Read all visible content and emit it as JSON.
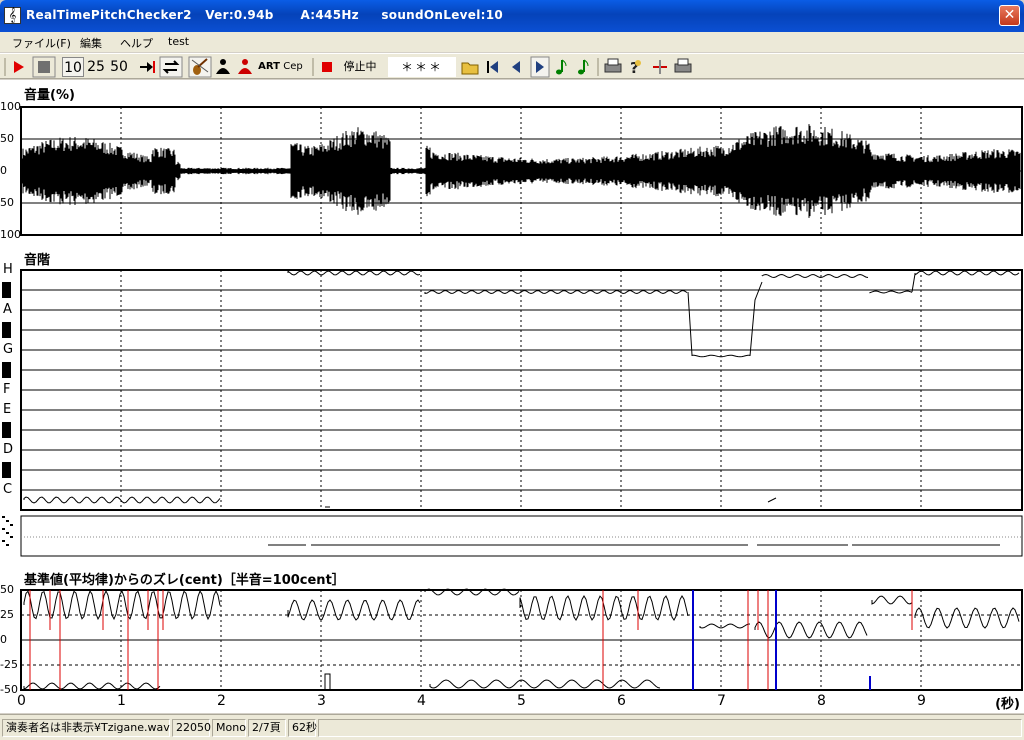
{
  "window": {
    "title": "RealTimePitchChecker2   Ver:0.94b      A:445Hz     soundOnLevel:10",
    "app_icon": "𝄞",
    "close_glyph": "✕"
  },
  "menu": [
    "ファイル(F)",
    "編集",
    "ヘルプ",
    "test"
  ],
  "toolbar": {
    "zoom_options": [
      "10",
      "25",
      "50"
    ],
    "labels": {
      "art": "ART",
      "cep": "Cep"
    },
    "status": "停止中",
    "note_display": "＊＊＊",
    "icons": [
      "play-icon",
      "stop-icon",
      "zoom-10",
      "zoom-25",
      "zoom-50",
      "skip-to-end-icon",
      "loop-icon",
      "violin-icon",
      "person-black-icon",
      "person-red-icon",
      "art-button",
      "cep-button",
      "record-indicator-icon",
      "open-folder-icon",
      "first-icon",
      "prev-icon",
      "next-icon",
      "note-green-icon",
      "note-green2-icon",
      "print-icon",
      "help-icon",
      "cross-icon",
      "print2-icon"
    ]
  },
  "volume_panel": {
    "title": "音量(%)",
    "y_ticks": [
      "100",
      "50",
      "0",
      "50",
      "100"
    ]
  },
  "scale_panel": {
    "title": "音階",
    "notes": [
      "H",
      "A",
      "G",
      "F",
      "E",
      "D",
      "C"
    ]
  },
  "deviation_panel": {
    "title": "基準値(平均律)からのズレ(cent)［半音=100cent］",
    "y_ticks": [
      "50",
      "25",
      "0",
      "-25",
      "-50"
    ]
  },
  "time_axis": {
    "ticks": [
      "0",
      "1",
      "2",
      "3",
      "4",
      "5",
      "6",
      "7",
      "8",
      "9"
    ],
    "unit": "(秒)"
  },
  "statusbar": {
    "file": "演奏者名は非表示¥Tzigane.wav",
    "rate": "22050",
    "channel": "Mono",
    "page": "2/7頁",
    "duration": "62秒"
  },
  "colors": {
    "titlebar": "#0a5de6",
    "trace": "#000000",
    "red": "#d00000",
    "blue": "#0000c0"
  }
}
